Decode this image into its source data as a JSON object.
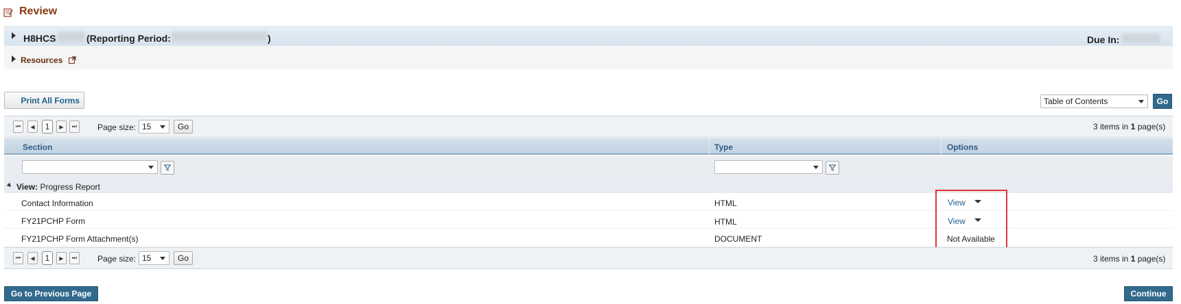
{
  "page": {
    "title": "Review"
  },
  "panel": {
    "grant_number": "H8HCS",
    "reporting_period_label": "(Reporting Period:",
    "reporting_period_close": ")",
    "due_label": "Due In:",
    "resources_label": "Resources"
  },
  "toolbar": {
    "print_all_label": "Print All Forms",
    "toc_selected": "Table of Contents",
    "go_label": "Go"
  },
  "pager": {
    "page": "1",
    "page_size_label": "Page size:",
    "page_size": "15",
    "go_label": "Go",
    "summary_prefix": "3 items in ",
    "summary_pages": "1",
    "summary_suffix": " page(s)"
  },
  "grid": {
    "columns": [
      "Section",
      "Type",
      "Options"
    ],
    "group_label": "View:",
    "group_value": "Progress Report",
    "rows": [
      {
        "section": "Contact Information",
        "type": "HTML",
        "option": "View"
      },
      {
        "section": "FY21PCHP Form",
        "type": "HTML",
        "option": "View"
      },
      {
        "section": "FY21PCHP Form Attachment(s)",
        "type": "DOCUMENT",
        "option": "Not Available"
      }
    ]
  },
  "footer": {
    "prev_label": "Go to Previous Page",
    "continue_label": "Continue"
  },
  "colors": {
    "title": "#8a3a14",
    "link": "#1d5f8c",
    "primary_button": "#316a8d",
    "highlight_box": "#e0343a"
  }
}
